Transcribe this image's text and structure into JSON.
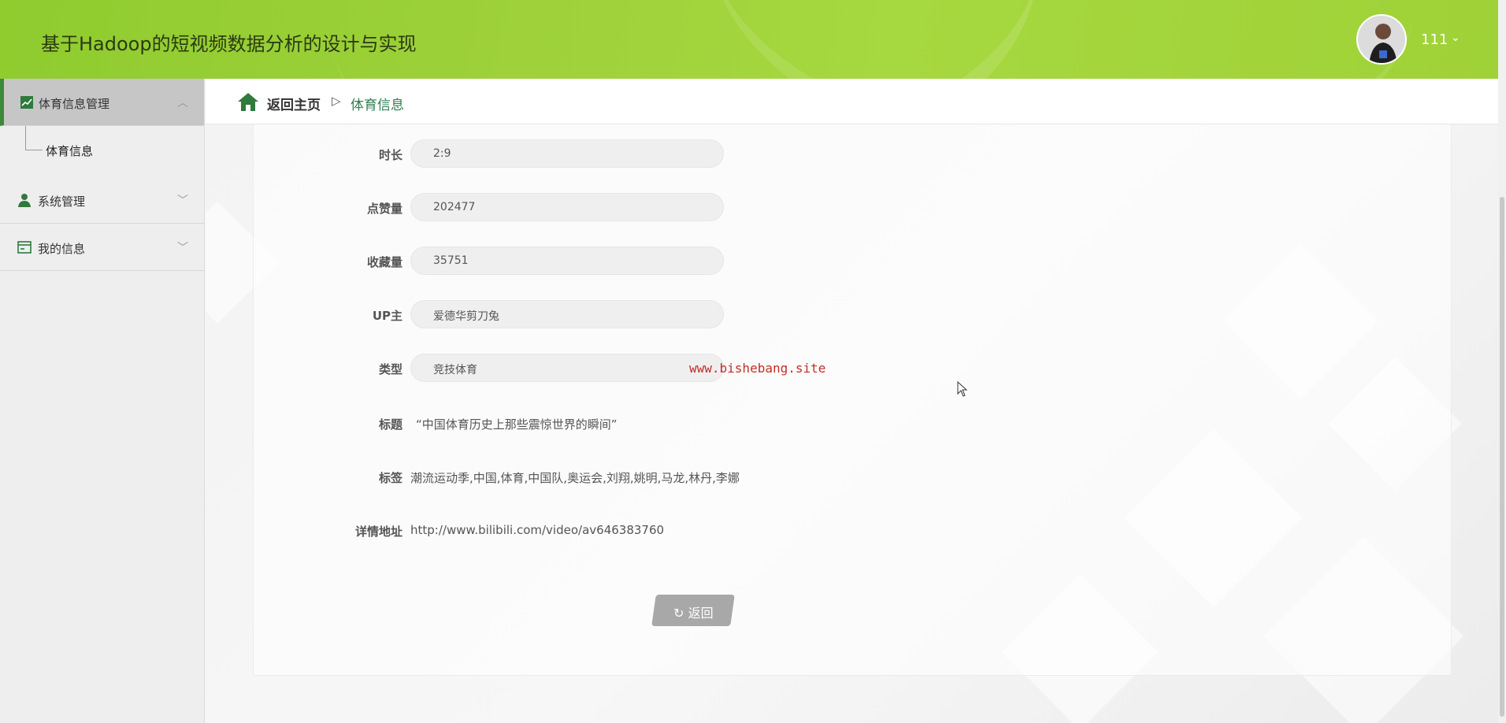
{
  "header": {
    "app_title": "基于Hadoop的短视频数据分析的设计与实现",
    "user_name": "111",
    "user_caret": "⌄"
  },
  "sidebar": {
    "groups": [
      {
        "label": "体育信息管理",
        "icon": "chart-line-icon",
        "expanded": true,
        "caret": "︿",
        "children": [
          {
            "label": "体育信息"
          }
        ]
      },
      {
        "label": "系统管理",
        "icon": "user-icon",
        "caret": "﹀"
      },
      {
        "label": "我的信息",
        "icon": "card-icon",
        "caret": "﹀"
      }
    ]
  },
  "breadcrumb": {
    "home": "返回主页",
    "separator": "▷",
    "current": "体育信息"
  },
  "form": {
    "duration_label": "时长",
    "duration_value": "2:9",
    "likes_label": "点赞量",
    "likes_value": "202477",
    "favorites_label": "收藏量",
    "favorites_value": "35751",
    "uploader_label": "UP主",
    "uploader_value": "爱德华剪刀兔",
    "type_label": "类型",
    "type_value": "竞技体育",
    "title_label": "标题",
    "title_value": "“中国体育历史上那些震惊世界的瞬间”",
    "tags_label": "标签",
    "tags_value": "潮流运动季,中国,体育,中国队,奥运会,刘翔,姚明,马龙,林丹,李娜",
    "url_label": "详情地址",
    "url_value": "http://www.bilibili.com/video/av646383760",
    "back_label": "返回"
  },
  "watermark": "www.bishebang.site",
  "colors": {
    "header_green": "#9ed13a",
    "accent_green": "#3a8a3a",
    "breadcrumb_current": "#2e7d4f",
    "watermark": "#c0302a"
  }
}
